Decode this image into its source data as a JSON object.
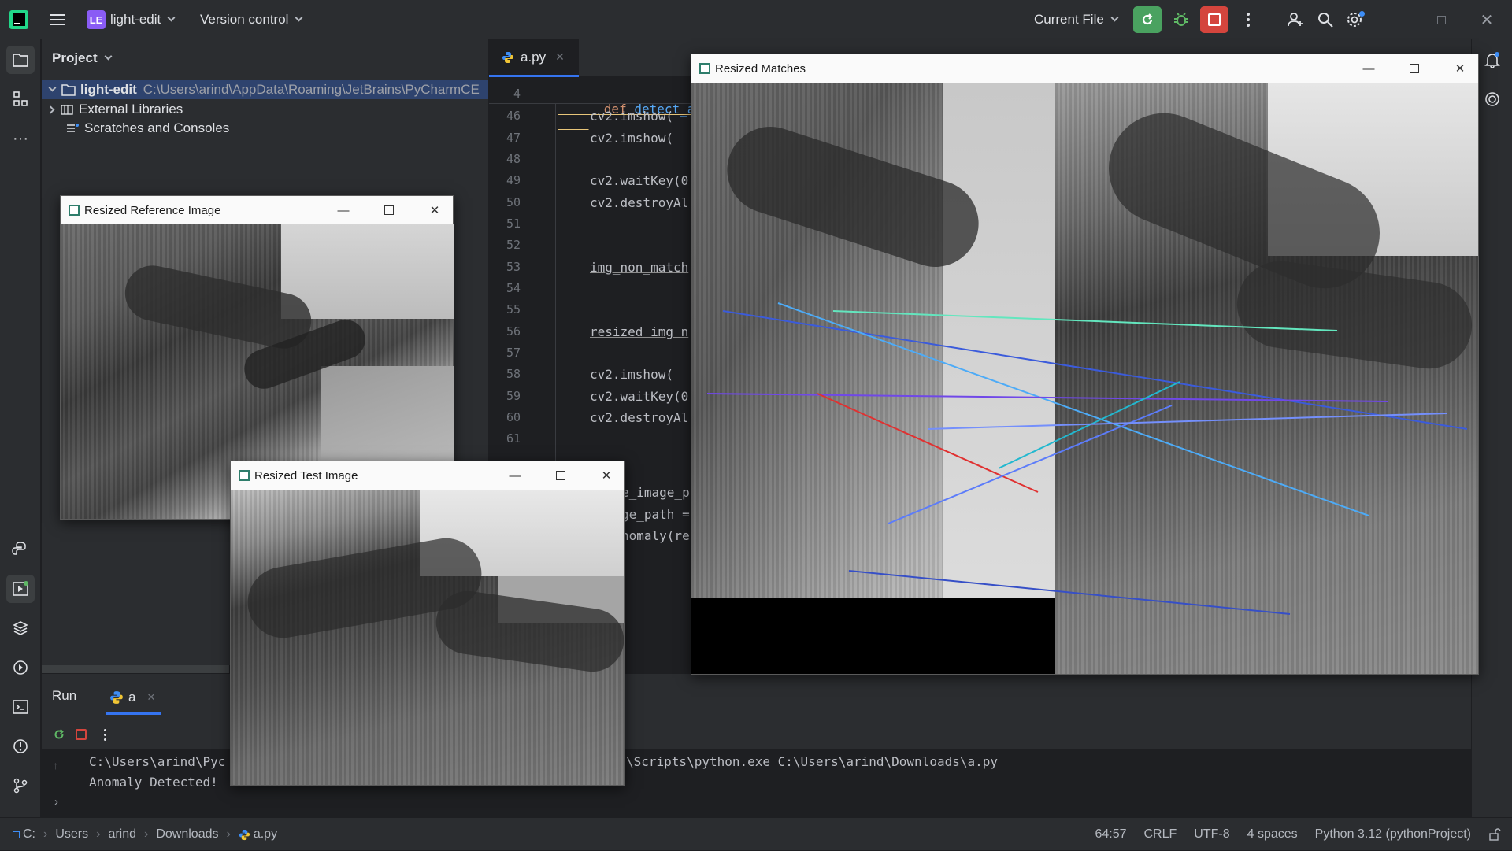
{
  "titlebar": {
    "logo_text": "LE",
    "project_name": "light-edit",
    "vcs_label": "Version control",
    "run_config": "Current File"
  },
  "project_panel": {
    "header": "Project",
    "tree": [
      {
        "label": "light-edit",
        "path": "C:\\Users\\arind\\AppData\\Roaming\\JetBrains\\PyCharmCE"
      },
      {
        "label": "External Libraries"
      },
      {
        "label": "Scratches and Consoles"
      }
    ]
  },
  "editor": {
    "tab_label": "a.py",
    "sticky_line_no": "4",
    "sticky_kw": "def",
    "sticky_fn": "detect_anomal",
    "lines": [
      {
        "no": "46",
        "text": "cv2.imshow("
      },
      {
        "no": "47",
        "text": "cv2.imshow("
      },
      {
        "no": "48",
        "text": ""
      },
      {
        "no": "49",
        "text": "cv2.waitKey(0"
      },
      {
        "no": "50",
        "text": "cv2.destroyAl"
      },
      {
        "no": "51",
        "text": ""
      },
      {
        "no": "52",
        "text": ""
      },
      {
        "no": "53",
        "text": "img_non_match"
      },
      {
        "no": "54",
        "text": ""
      },
      {
        "no": "55",
        "text": ""
      },
      {
        "no": "56",
        "text": "resized_img_n"
      },
      {
        "no": "57",
        "text": ""
      },
      {
        "no": "58",
        "text": "cv2.imshow("
      },
      {
        "no": "59",
        "text": "cv2.waitKey(0"
      },
      {
        "no": "60",
        "text": "cv2.destroyAl"
      },
      {
        "no": "61",
        "text": ""
      }
    ],
    "peek_lines": [
      "e_image_p",
      "ge_path =",
      "nomaly(re"
    ]
  },
  "windows": {
    "reference": {
      "title": "Resized Reference Image"
    },
    "test": {
      "title": "Resized Test Image"
    },
    "matches": {
      "title": "Resized Matches"
    }
  },
  "run_panel": {
    "title": "Run",
    "tab": "a",
    "console_line1_left": "C:\\Users\\arind\\Pyc",
    "console_line1_right": "\\Scripts\\python.exe C:\\Users\\arind\\Downloads\\a.py",
    "console_line2": "Anomaly Detected!"
  },
  "statusbar": {
    "breadcrumbs": [
      "C:",
      "Users",
      "arind",
      "Downloads",
      "a.py"
    ],
    "position": "64:57",
    "line_sep": "CRLF",
    "encoding": "UTF-8",
    "indent": "4 spaces",
    "interpreter": "Python 3.12 (pythonProject)"
  },
  "colors": {
    "ide_bg": "#1e1f22",
    "panel_bg": "#2b2d30",
    "logo_purple": "#8a5cf5",
    "run_green": "#4aa260",
    "stop_red": "#d4453d",
    "keyword": "#cf8e6d",
    "function": "#56a8f5"
  }
}
